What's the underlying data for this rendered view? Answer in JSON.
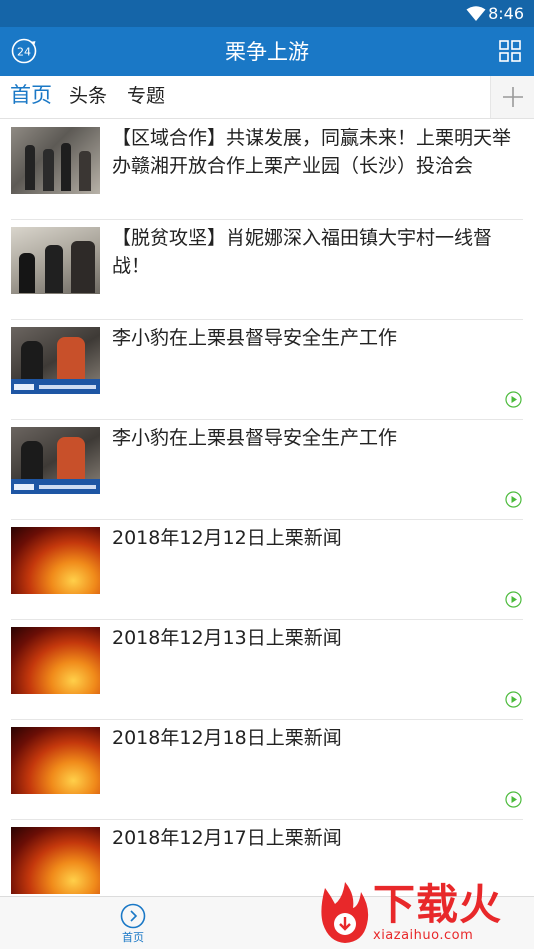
{
  "status_bar": {
    "time": "8:46"
  },
  "app_bar": {
    "title": "栗争上游",
    "logo_text": "24"
  },
  "tabs": [
    {
      "label": "首页",
      "active": true
    },
    {
      "label": "头条",
      "active": false
    },
    {
      "label": "专题",
      "active": false
    }
  ],
  "news": [
    {
      "title": "【区域合作】共谋发展，同赢未来！上栗明天举办赣湘开放合作上栗产业园（长沙）投洽会",
      "thumb": "photo-office",
      "video": false
    },
    {
      "title": "【脱贫攻坚】肖妮娜深入福田镇大宇村一线督战！",
      "thumb": "photo-village",
      "video": false
    },
    {
      "title": "李小豹在上栗县督导安全生产工作",
      "thumb": "video-frame",
      "video": true
    },
    {
      "title": "李小豹在上栗县督导安全生产工作",
      "thumb": "video-frame",
      "video": true
    },
    {
      "title": "2018年12月12日上栗新闻",
      "thumb": "fire",
      "video": true
    },
    {
      "title": "2018年12月13日上栗新闻",
      "thumb": "fire",
      "video": true
    },
    {
      "title": "2018年12月18日上栗新闻",
      "thumb": "fire",
      "video": true
    },
    {
      "title": "2018年12月17日上栗新闻",
      "thumb": "fire",
      "video": false
    }
  ],
  "bottom_nav": {
    "home_label": "首页"
  },
  "watermark": {
    "text": "下载火",
    "url": "xiazaihuo.com"
  },
  "colors": {
    "primary": "#1a78c6",
    "status_bar": "#1565a8",
    "video_icon": "#4cbb3c",
    "watermark": "#e8282a"
  },
  "icons": {
    "app_logo": "clock-24-icon",
    "grid": "grid-icon",
    "add": "plus-icon",
    "play": "play-circle-icon",
    "home": "home-circle-icon"
  }
}
